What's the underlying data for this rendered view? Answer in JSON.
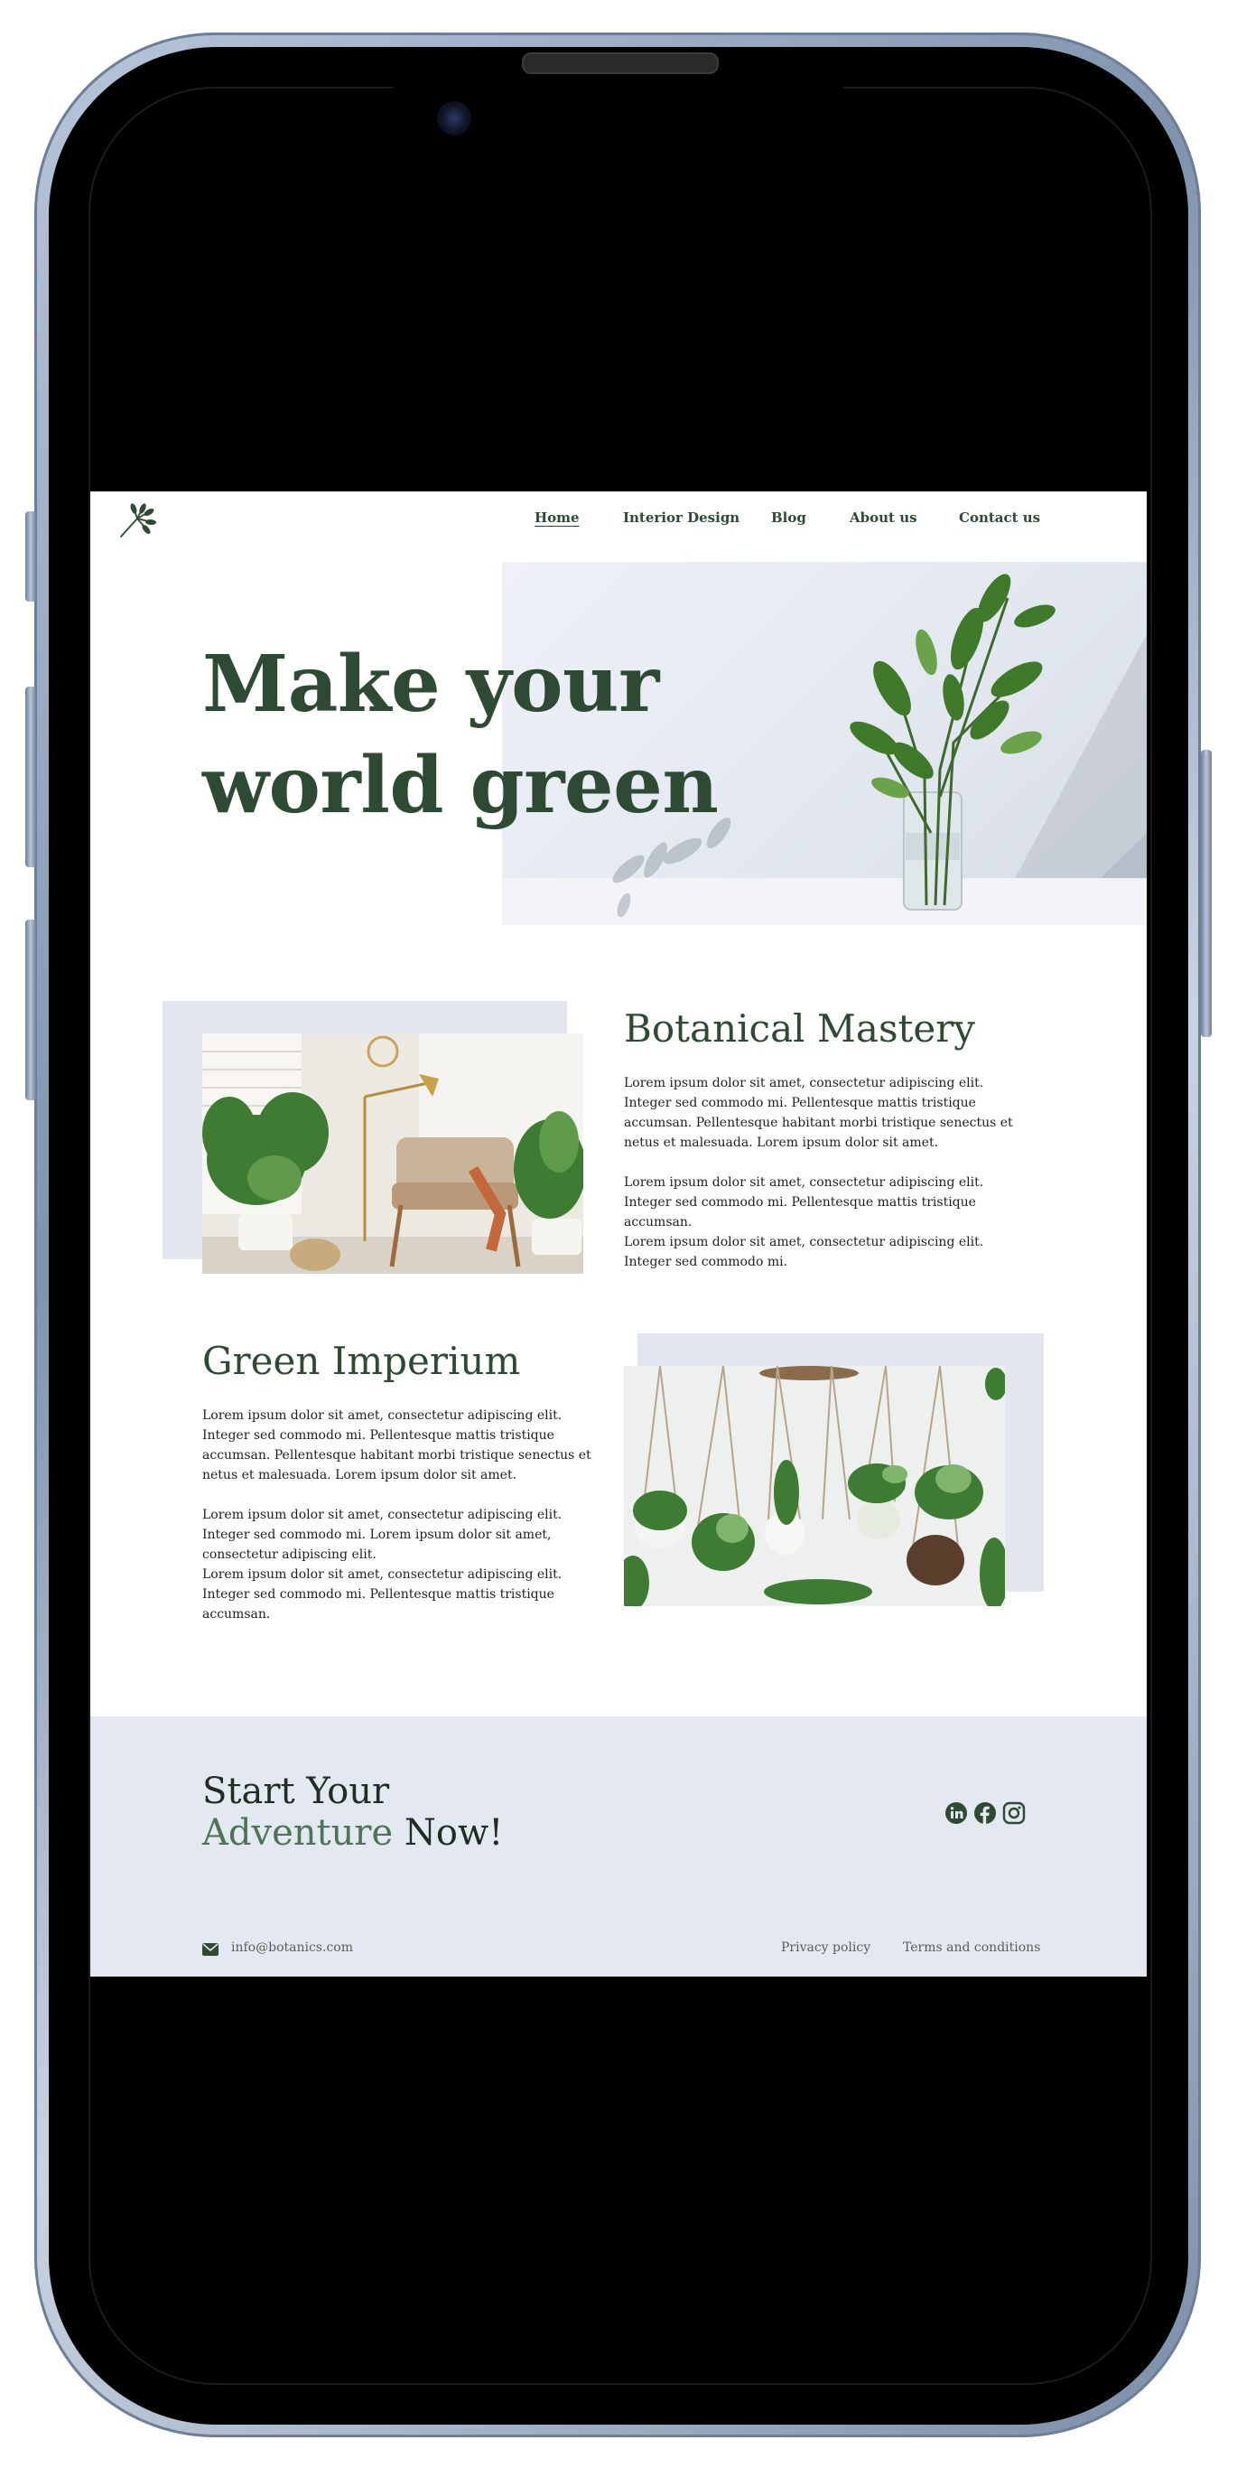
{
  "nav": {
    "items": [
      {
        "label": "Home",
        "active": true
      },
      {
        "label": "Interior Design"
      },
      {
        "label": "Blog"
      },
      {
        "label": "About us"
      },
      {
        "label": "Contact us"
      }
    ]
  },
  "hero": {
    "line1": "Make your",
    "line2": "world green"
  },
  "section1": {
    "title": "Botanical Mastery",
    "paragraphs": [
      "Lorem ipsum dolor sit amet, consectetur adipiscing elit. Integer sed commodo mi. Pellentesque mattis tristique accumsan. Pellentesque habitant morbi tristique senectus et netus et malesuada. Lorem ipsum dolor sit amet.",
      "Lorem ipsum dolor sit amet, consectetur adipiscing elit. Integer sed commodo mi. Pellentesque mattis tristique accumsan.",
      "Lorem ipsum dolor sit amet, consectetur adipiscing elit. Integer sed commodo mi."
    ]
  },
  "section2": {
    "title": "Green Imperium",
    "paragraphs": [
      "Lorem ipsum dolor sit amet, consectetur adipiscing elit. Integer sed commodo mi. Pellentesque mattis tristique accumsan. Pellentesque habitant morbi tristique senectus et netus et malesuada. Lorem ipsum dolor sit amet.",
      "Lorem ipsum dolor sit amet, consectetur adipiscing elit. Integer sed commodo mi. Lorem ipsum dolor sit amet, consectetur adipiscing elit.",
      "Lorem ipsum dolor sit amet, consectetur adipiscing elit. Integer sed commodo mi. Pellentesque mattis tristique accumsan."
    ]
  },
  "footer": {
    "cta_line1": "Start Your",
    "cta_line2_accent": "Adventure",
    "cta_line2_rest": " Now!",
    "email": "info@botanics.com",
    "privacy": "Privacy policy",
    "terms": "Terms and conditions",
    "social_icons": [
      "linkedin-icon",
      "facebook-icon",
      "instagram-icon"
    ]
  },
  "colors": {
    "brand_green": "#2f4a34",
    "panel_blue": "#e1e6f0",
    "footer_bg": "#e3e8f1"
  }
}
